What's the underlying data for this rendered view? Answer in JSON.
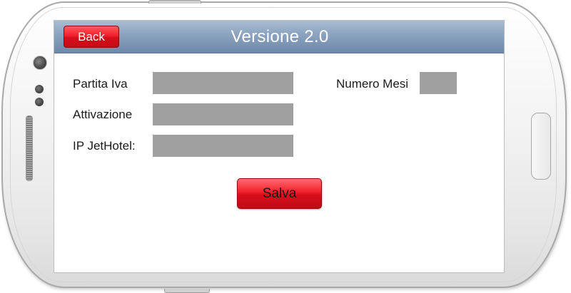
{
  "header": {
    "back_label": "Back",
    "title": "Versione 2.0"
  },
  "form": {
    "partita_iva_label": "Partita Iva",
    "partita_iva_value": "",
    "attivazione_label": "Attivazione",
    "attivazione_value": "",
    "ip_jethotel_label": "IP JetHotel:",
    "ip_jethotel_value": "",
    "numero_mesi_label": "Numero Mesi",
    "numero_mesi_value": ""
  },
  "actions": {
    "save_label": "Salva"
  },
  "colors": {
    "titlebar": "#8aa2be",
    "button_red": "#e3141f",
    "field_gray": "#a0a0a0",
    "screen_background": "#ffffff",
    "device_body": "#f0f0f0"
  },
  "icons": {
    "camera": "camera-icon",
    "sensors": "sensor-icon",
    "speaker": "speaker-grille-icon",
    "home_button": "home-button-icon"
  }
}
